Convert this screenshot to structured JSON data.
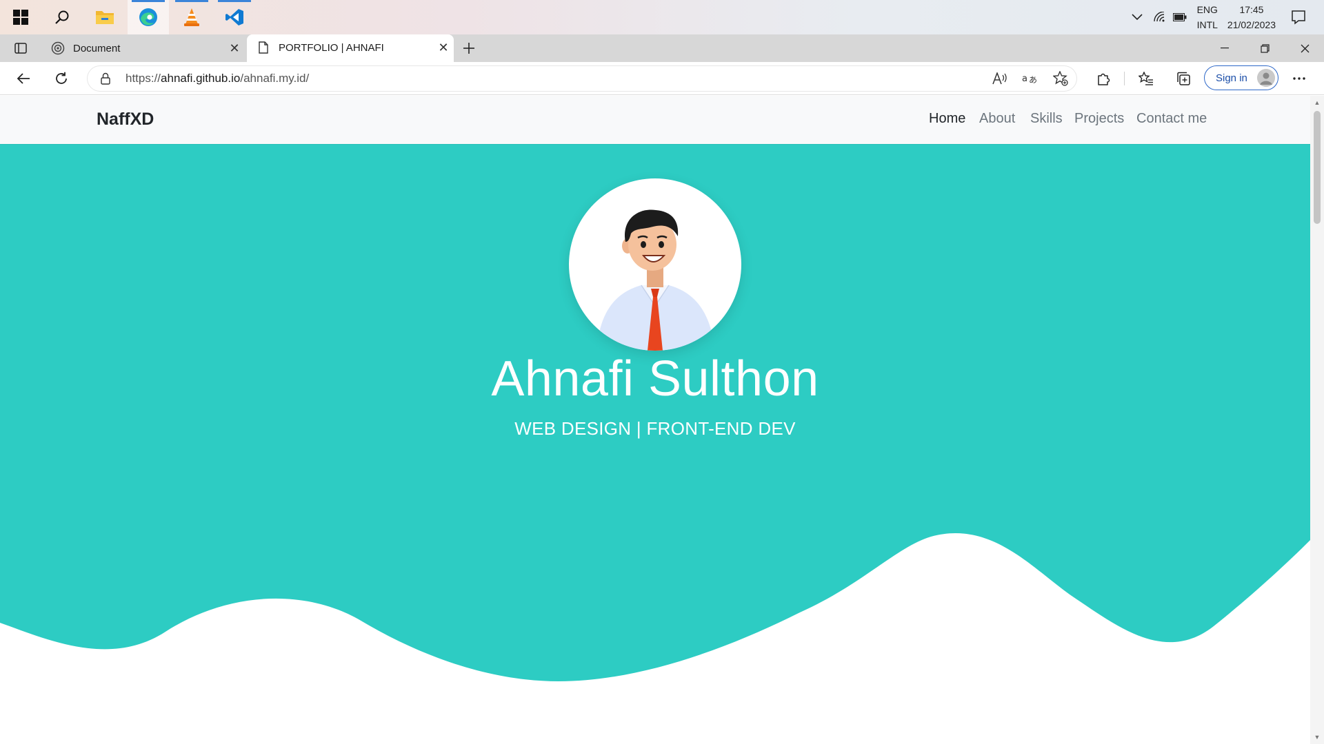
{
  "taskbar": {
    "apps": [
      "windows-start",
      "search",
      "file-explorer",
      "edge",
      "vlc",
      "vscode"
    ],
    "tray": {
      "language_top": "ENG",
      "language_bottom": "INTL",
      "time": "17:45",
      "date": "21/02/2023"
    }
  },
  "browser": {
    "tabs": [
      {
        "title": "Document",
        "active": false
      },
      {
        "title": "PORTFOLIO | AHNAFI",
        "active": true
      }
    ],
    "url_prefix": "https://",
    "url_host": "ahnafi.github.io",
    "url_path": "/ahnafi.my.id/",
    "signin_label": "Sign in"
  },
  "page": {
    "brand": "NaffXD",
    "nav": [
      "Home",
      "About",
      "Skills",
      "Projects",
      "Contact me"
    ],
    "active_nav": "Home",
    "hero_name": "Ahnafi Sulthon",
    "hero_subtitle": "WEB DESIGN | FRONT-END DEV"
  },
  "colors": {
    "hero_bg": "#2dccc3",
    "navbar_bg": "#f8f9fa",
    "accent_blue": "#2c67c8",
    "tie": "#e8451f"
  }
}
